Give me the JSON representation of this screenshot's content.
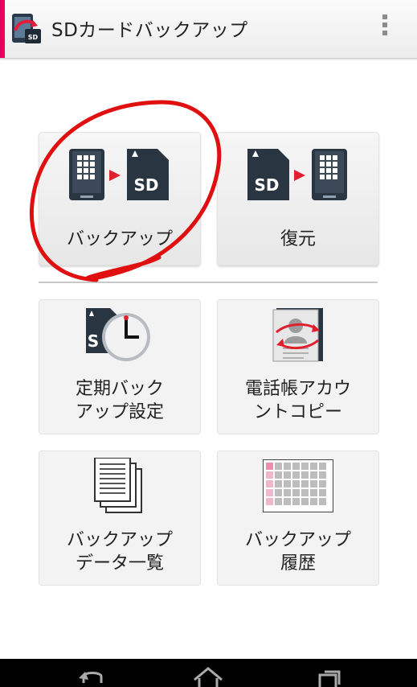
{
  "app": {
    "title": "SDカードバックアップ",
    "accent_color": "#e6005c",
    "icon": "sd-backup-app-icon"
  },
  "menu": {
    "icon": "overflow-menu-icon"
  },
  "primary_actions": [
    {
      "label": "バックアップ",
      "icon": "phone-to-sd-icon"
    },
    {
      "label": "復元",
      "icon": "sd-to-phone-icon"
    }
  ],
  "secondary_actions": [
    {
      "label_lines": [
        "定期バック",
        "アップ設定"
      ],
      "icon": "scheduled-backup-clock-icon"
    },
    {
      "label_lines": [
        "電話帳アカウ",
        "ントコピー"
      ],
      "icon": "contacts-copy-icon"
    },
    {
      "label_lines": [
        "バックアップ",
        "データ一覧"
      ],
      "icon": "backup-data-list-icon"
    },
    {
      "label_lines": [
        "バックアップ",
        "履歴"
      ],
      "icon": "backup-history-calendar-icon"
    }
  ],
  "nav": {
    "back_icon": "back-icon",
    "home_icon": "home-icon",
    "recents_icon": "recent-apps-icon"
  },
  "annotation": {
    "color": "#e01010"
  }
}
